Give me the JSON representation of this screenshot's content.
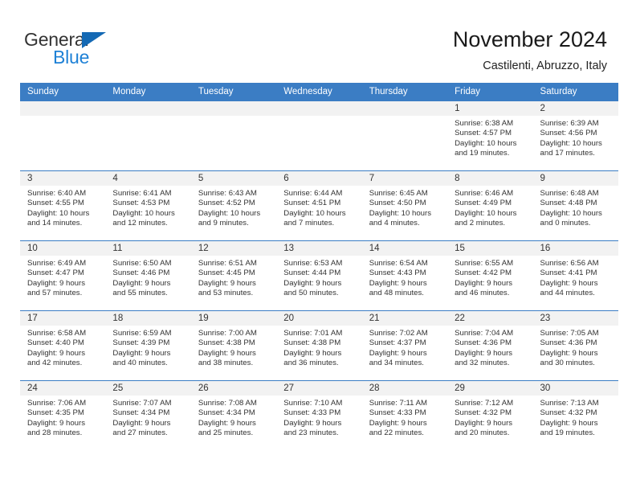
{
  "logo": {
    "primary_text": "General",
    "secondary_text": "Blue",
    "primary_color": "#333333",
    "secondary_color": "#1e81d6",
    "triangle_color": "#1469b4",
    "icon": "triangle-icon"
  },
  "header": {
    "title": "November 2024",
    "subtitle": "Castilenti, Abruzzo, Italy"
  },
  "theme": {
    "header_row_bg": "#3b7dc4",
    "header_row_text": "#ffffff",
    "daynum_bg": "#f2f2f2",
    "cell_border": "#3b7dc4",
    "body_text": "#333333"
  },
  "calendar": {
    "weekday_headers": [
      "Sunday",
      "Monday",
      "Tuesday",
      "Wednesday",
      "Thursday",
      "Friday",
      "Saturday"
    ],
    "weeks": [
      [
        {
          "day": "",
          "sunrise": "",
          "sunset": "",
          "daylight": "",
          "daylight2": "",
          "empty": true
        },
        {
          "day": "",
          "sunrise": "",
          "sunset": "",
          "daylight": "",
          "daylight2": "",
          "empty": true
        },
        {
          "day": "",
          "sunrise": "",
          "sunset": "",
          "daylight": "",
          "daylight2": "",
          "empty": true
        },
        {
          "day": "",
          "sunrise": "",
          "sunset": "",
          "daylight": "",
          "daylight2": "",
          "empty": true
        },
        {
          "day": "",
          "sunrise": "",
          "sunset": "",
          "daylight": "",
          "daylight2": "",
          "empty": true
        },
        {
          "day": "1",
          "sunrise": "Sunrise: 6:38 AM",
          "sunset": "Sunset: 4:57 PM",
          "daylight": "Daylight: 10 hours",
          "daylight2": "and 19 minutes.",
          "empty": false
        },
        {
          "day": "2",
          "sunrise": "Sunrise: 6:39 AM",
          "sunset": "Sunset: 4:56 PM",
          "daylight": "Daylight: 10 hours",
          "daylight2": "and 17 minutes.",
          "empty": false
        }
      ],
      [
        {
          "day": "3",
          "sunrise": "Sunrise: 6:40 AM",
          "sunset": "Sunset: 4:55 PM",
          "daylight": "Daylight: 10 hours",
          "daylight2": "and 14 minutes.",
          "empty": false
        },
        {
          "day": "4",
          "sunrise": "Sunrise: 6:41 AM",
          "sunset": "Sunset: 4:53 PM",
          "daylight": "Daylight: 10 hours",
          "daylight2": "and 12 minutes.",
          "empty": false
        },
        {
          "day": "5",
          "sunrise": "Sunrise: 6:43 AM",
          "sunset": "Sunset: 4:52 PM",
          "daylight": "Daylight: 10 hours",
          "daylight2": "and 9 minutes.",
          "empty": false
        },
        {
          "day": "6",
          "sunrise": "Sunrise: 6:44 AM",
          "sunset": "Sunset: 4:51 PM",
          "daylight": "Daylight: 10 hours",
          "daylight2": "and 7 minutes.",
          "empty": false
        },
        {
          "day": "7",
          "sunrise": "Sunrise: 6:45 AM",
          "sunset": "Sunset: 4:50 PM",
          "daylight": "Daylight: 10 hours",
          "daylight2": "and 4 minutes.",
          "empty": false
        },
        {
          "day": "8",
          "sunrise": "Sunrise: 6:46 AM",
          "sunset": "Sunset: 4:49 PM",
          "daylight": "Daylight: 10 hours",
          "daylight2": "and 2 minutes.",
          "empty": false
        },
        {
          "day": "9",
          "sunrise": "Sunrise: 6:48 AM",
          "sunset": "Sunset: 4:48 PM",
          "daylight": "Daylight: 10 hours",
          "daylight2": "and 0 minutes.",
          "empty": false
        }
      ],
      [
        {
          "day": "10",
          "sunrise": "Sunrise: 6:49 AM",
          "sunset": "Sunset: 4:47 PM",
          "daylight": "Daylight: 9 hours",
          "daylight2": "and 57 minutes.",
          "empty": false
        },
        {
          "day": "11",
          "sunrise": "Sunrise: 6:50 AM",
          "sunset": "Sunset: 4:46 PM",
          "daylight": "Daylight: 9 hours",
          "daylight2": "and 55 minutes.",
          "empty": false
        },
        {
          "day": "12",
          "sunrise": "Sunrise: 6:51 AM",
          "sunset": "Sunset: 4:45 PM",
          "daylight": "Daylight: 9 hours",
          "daylight2": "and 53 minutes.",
          "empty": false
        },
        {
          "day": "13",
          "sunrise": "Sunrise: 6:53 AM",
          "sunset": "Sunset: 4:44 PM",
          "daylight": "Daylight: 9 hours",
          "daylight2": "and 50 minutes.",
          "empty": false
        },
        {
          "day": "14",
          "sunrise": "Sunrise: 6:54 AM",
          "sunset": "Sunset: 4:43 PM",
          "daylight": "Daylight: 9 hours",
          "daylight2": "and 48 minutes.",
          "empty": false
        },
        {
          "day": "15",
          "sunrise": "Sunrise: 6:55 AM",
          "sunset": "Sunset: 4:42 PM",
          "daylight": "Daylight: 9 hours",
          "daylight2": "and 46 minutes.",
          "empty": false
        },
        {
          "day": "16",
          "sunrise": "Sunrise: 6:56 AM",
          "sunset": "Sunset: 4:41 PM",
          "daylight": "Daylight: 9 hours",
          "daylight2": "and 44 minutes.",
          "empty": false
        }
      ],
      [
        {
          "day": "17",
          "sunrise": "Sunrise: 6:58 AM",
          "sunset": "Sunset: 4:40 PM",
          "daylight": "Daylight: 9 hours",
          "daylight2": "and 42 minutes.",
          "empty": false
        },
        {
          "day": "18",
          "sunrise": "Sunrise: 6:59 AM",
          "sunset": "Sunset: 4:39 PM",
          "daylight": "Daylight: 9 hours",
          "daylight2": "and 40 minutes.",
          "empty": false
        },
        {
          "day": "19",
          "sunrise": "Sunrise: 7:00 AM",
          "sunset": "Sunset: 4:38 PM",
          "daylight": "Daylight: 9 hours",
          "daylight2": "and 38 minutes.",
          "empty": false
        },
        {
          "day": "20",
          "sunrise": "Sunrise: 7:01 AM",
          "sunset": "Sunset: 4:38 PM",
          "daylight": "Daylight: 9 hours",
          "daylight2": "and 36 minutes.",
          "empty": false
        },
        {
          "day": "21",
          "sunrise": "Sunrise: 7:02 AM",
          "sunset": "Sunset: 4:37 PM",
          "daylight": "Daylight: 9 hours",
          "daylight2": "and 34 minutes.",
          "empty": false
        },
        {
          "day": "22",
          "sunrise": "Sunrise: 7:04 AM",
          "sunset": "Sunset: 4:36 PM",
          "daylight": "Daylight: 9 hours",
          "daylight2": "and 32 minutes.",
          "empty": false
        },
        {
          "day": "23",
          "sunrise": "Sunrise: 7:05 AM",
          "sunset": "Sunset: 4:36 PM",
          "daylight": "Daylight: 9 hours",
          "daylight2": "and 30 minutes.",
          "empty": false
        }
      ],
      [
        {
          "day": "24",
          "sunrise": "Sunrise: 7:06 AM",
          "sunset": "Sunset: 4:35 PM",
          "daylight": "Daylight: 9 hours",
          "daylight2": "and 28 minutes.",
          "empty": false
        },
        {
          "day": "25",
          "sunrise": "Sunrise: 7:07 AM",
          "sunset": "Sunset: 4:34 PM",
          "daylight": "Daylight: 9 hours",
          "daylight2": "and 27 minutes.",
          "empty": false
        },
        {
          "day": "26",
          "sunrise": "Sunrise: 7:08 AM",
          "sunset": "Sunset: 4:34 PM",
          "daylight": "Daylight: 9 hours",
          "daylight2": "and 25 minutes.",
          "empty": false
        },
        {
          "day": "27",
          "sunrise": "Sunrise: 7:10 AM",
          "sunset": "Sunset: 4:33 PM",
          "daylight": "Daylight: 9 hours",
          "daylight2": "and 23 minutes.",
          "empty": false
        },
        {
          "day": "28",
          "sunrise": "Sunrise: 7:11 AM",
          "sunset": "Sunset: 4:33 PM",
          "daylight": "Daylight: 9 hours",
          "daylight2": "and 22 minutes.",
          "empty": false
        },
        {
          "day": "29",
          "sunrise": "Sunrise: 7:12 AM",
          "sunset": "Sunset: 4:32 PM",
          "daylight": "Daylight: 9 hours",
          "daylight2": "and 20 minutes.",
          "empty": false
        },
        {
          "day": "30",
          "sunrise": "Sunrise: 7:13 AM",
          "sunset": "Sunset: 4:32 PM",
          "daylight": "Daylight: 9 hours",
          "daylight2": "and 19 minutes.",
          "empty": false
        }
      ]
    ]
  }
}
